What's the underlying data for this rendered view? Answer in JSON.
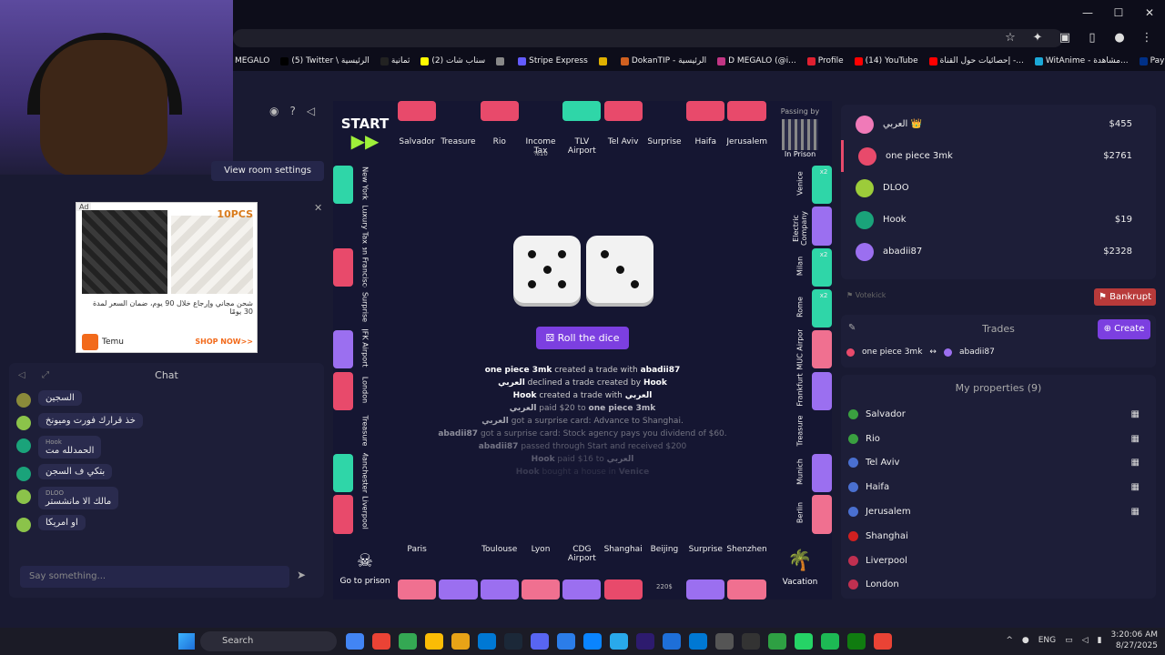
{
  "browser": {
    "controls": {
      "minimize": "—",
      "maximize": "☐",
      "close": "✕"
    },
    "bookmarks": [
      {
        "label": "MEGALO",
        "color": ""
      },
      {
        "label": "(5) Twitter \\ الرئيسية",
        "color": "#000"
      },
      {
        "label": "ثمانية",
        "color": "#222"
      },
      {
        "label": "(2) سناب شات",
        "color": "#fffc00"
      },
      {
        "label": "",
        "color": "#888"
      },
      {
        "label": "Stripe Express",
        "color": "#635bff"
      },
      {
        "label": "",
        "color": "#e0b000"
      },
      {
        "label": "DokanTIP - الرئيسية",
        "color": "#d06020"
      },
      {
        "label": "D MEGALO (@i...",
        "color": "#c13584"
      },
      {
        "label": "Profile",
        "color": "#e02030"
      },
      {
        "label": "(14) YouTube",
        "color": "#ff0000"
      },
      {
        "label": "إحصائيات حول القناة -...",
        "color": "#ff0000"
      },
      {
        "label": "WitAnime - مشاهدة...",
        "color": "#1ba8d8"
      },
      {
        "label": "PayPal: الموجز",
        "color": "#003087"
      }
    ]
  },
  "room": {
    "view_room_settings": "View room settings"
  },
  "ad": {
    "tag": "Ad",
    "badge": "10PCS",
    "text": "شحن مجاني وإرجاع خلال 90 يوم، ضمان السعر لمدة 30 يومًا",
    "brand": "Temu",
    "shop_now": "SHOP NOW>>",
    "close": "✕"
  },
  "chat": {
    "title": "Chat",
    "messages": [
      {
        "name": "",
        "text": "السجين",
        "color": "#8a8a3a"
      },
      {
        "name": "",
        "text": "خذ قرارك فورت وميونخ",
        "color": "#8bc34a"
      },
      {
        "name": "Hook",
        "text": "الحمدلله مت",
        "color": "#1aa37a"
      },
      {
        "name": "",
        "text": "بتكي ف السجن",
        "color": "#1aa37a"
      },
      {
        "name": "DLOO",
        "text": "مالك الا مانشستر",
        "color": "#8bc34a"
      },
      {
        "name": "",
        "text": "او امريكا",
        "color": "#8bc34a"
      }
    ],
    "placeholder": "Say something..."
  },
  "board": {
    "corners": {
      "start": "START",
      "passing_by": "Passing by",
      "in_prison": "In Prison",
      "go_to_prison": "Go to prison",
      "vacation": "Vacation"
    },
    "top": [
      {
        "name": "Salvador",
        "color": "#e84a6b"
      },
      {
        "name": "Treasure",
        "color": ""
      },
      {
        "name": "Rio",
        "color": "#e84a6b"
      },
      {
        "name": "Income Tax",
        "sub": "%10",
        "color": ""
      },
      {
        "name": "TLV Airport",
        "color": "#2fd6a8"
      },
      {
        "name": "Tel Aviv",
        "color": "#e84a6b"
      },
      {
        "name": "Surprise",
        "color": ""
      },
      {
        "name": "Haifa",
        "color": "#e84a6b"
      },
      {
        "name": "Jerusalem",
        "color": "#e84a6b"
      }
    ],
    "left": [
      {
        "name": "New York",
        "color": "#2fd6a8"
      },
      {
        "name": "Luxury Tax",
        "sub": "75$",
        "color": ""
      },
      {
        "name": "San Francisco",
        "color": "#e84a6b"
      },
      {
        "name": "Surprise",
        "color": ""
      },
      {
        "name": "JFK Airport",
        "color": "#9b6ff0"
      },
      {
        "name": "London",
        "color": "#e84a6b"
      },
      {
        "name": "Treasure",
        "color": ""
      },
      {
        "name": "Manchester",
        "color": "#2fd6a8"
      },
      {
        "name": "Liverpool",
        "color": "#e84a6b"
      }
    ],
    "right": [
      {
        "name": "Venice",
        "color": "#2fd6a8",
        "x2": "x2"
      },
      {
        "name": "Electric Company",
        "color": "#9b6ff0"
      },
      {
        "name": "Milan",
        "color": "#2fd6a8",
        "x2": "x2"
      },
      {
        "name": "Rome",
        "color": "#2fd6a8",
        "x2": "x2"
      },
      {
        "name": "MUC Airport",
        "color": "#f07090"
      },
      {
        "name": "Frankfurt",
        "color": "#9b6ff0"
      },
      {
        "name": "Treasure",
        "color": ""
      },
      {
        "name": "Munich",
        "color": "#9b6ff0"
      },
      {
        "name": "Berlin",
        "color": "#f07090"
      }
    ],
    "bottom": [
      {
        "name": "Paris",
        "color": "#f07090"
      },
      {
        "name": "",
        "color": "#9b6ff0"
      },
      {
        "name": "Toulouse",
        "color": "#9b6ff0"
      },
      {
        "name": "Lyon",
        "color": "#f07090"
      },
      {
        "name": "CDG Airport",
        "color": "#9b6ff0"
      },
      {
        "name": "Shanghai",
        "color": "#e84a6b"
      },
      {
        "name": "Beijing",
        "sub": "220$",
        "color": ""
      },
      {
        "name": "Surprise",
        "color": "#9b6ff0"
      },
      {
        "name": "Shenzhen",
        "color": "#f07090"
      }
    ],
    "roll_button": "Roll the dice",
    "dice": [
      5,
      3
    ],
    "log": [
      {
        "parts": [
          "one piece 3mk",
          " created a trade with ",
          "abadii87"
        ],
        "opacity": 1
      },
      {
        "parts": [
          "العربي",
          " declined a trade created by ",
          "Hook"
        ],
        "opacity": 1
      },
      {
        "parts": [
          "Hook",
          " created a trade with ",
          "العربي"
        ],
        "opacity": 1
      },
      {
        "parts": [
          "العربي",
          " paid $20 to ",
          "one piece 3mk"
        ],
        "opacity": 0.7
      },
      {
        "parts": [
          "العربي",
          " got a surprise card: Advance to Shanghai.",
          ""
        ],
        "opacity": 0.6
      },
      {
        "parts": [
          "abadii87",
          " got a surprise card: Stock agency pays you dividend of $60.",
          ""
        ],
        "opacity": 0.5
      },
      {
        "parts": [
          "abadii87",
          " passed through Start and received $200",
          ""
        ],
        "opacity": 0.4
      },
      {
        "parts": [
          "Hook",
          " paid $16 to ",
          "العربي"
        ],
        "opacity": 0.3
      },
      {
        "parts": [
          "Hook",
          " bought a house in ",
          "Venice"
        ],
        "opacity": 0.15
      }
    ]
  },
  "players": [
    {
      "name": "العربي 👑",
      "money": "$455",
      "color": "#f07ab8"
    },
    {
      "name": "one piece 3mk",
      "money": "$2761",
      "color": "#e84a6b"
    },
    {
      "name": "DLOO",
      "money": "",
      "color": "#9ccc3a"
    },
    {
      "name": "Hook",
      "money": "$19",
      "color": "#1aa37a"
    },
    {
      "name": "abadii87",
      "money": "$2328",
      "color": "#9b6ff0"
    }
  ],
  "votekick": "Votekick",
  "bankrupt": "Bankrupt",
  "trades": {
    "title": "Trades",
    "create": "Create",
    "item": {
      "from": "one piece 3mk",
      "arrow": "↔",
      "to": "abadii87"
    }
  },
  "properties": {
    "title": "My properties (9)",
    "items": [
      {
        "name": "Salvador",
        "color": "#3aa040"
      },
      {
        "name": "Rio",
        "color": "#3aa040"
      },
      {
        "name": "Tel Aviv",
        "color": "#4a70d0"
      },
      {
        "name": "Haifa",
        "color": "#4a70d0"
      },
      {
        "name": "Jerusalem",
        "color": "#4a70d0"
      },
      {
        "name": "Shanghai",
        "color": "#d02020"
      },
      {
        "name": "Liverpool",
        "color": "#c03050"
      },
      {
        "name": "London",
        "color": "#c03050"
      }
    ]
  },
  "taskbar": {
    "search": "Search",
    "lang": "ENG",
    "time": "3:20:06 AM",
    "date": "8/27/2025"
  }
}
